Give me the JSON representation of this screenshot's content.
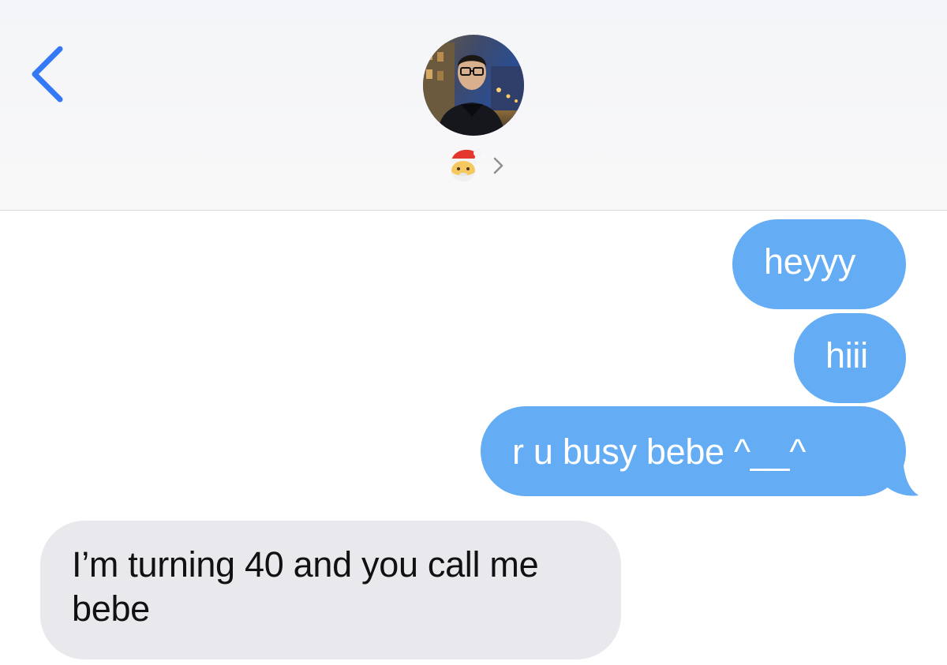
{
  "header": {
    "back_icon": "chevron-left-icon",
    "avatar_icon": "contact-photo",
    "contact_name_emoji": "🎅",
    "detail_chevron_icon": "chevron-right-icon"
  },
  "colors": {
    "accent": "#3478f6",
    "sent_bubble": "#64acf4",
    "received_bubble": "#e8e8ed",
    "header_bg": "#f7f7f9"
  },
  "messages": [
    {
      "direction": "sent",
      "text": "heyyy"
    },
    {
      "direction": "sent",
      "text": "hiii"
    },
    {
      "direction": "sent",
      "text": "r u busy bebe ^__^"
    },
    {
      "direction": "received",
      "text": "I’m turning 40 and you call me bebe"
    }
  ]
}
